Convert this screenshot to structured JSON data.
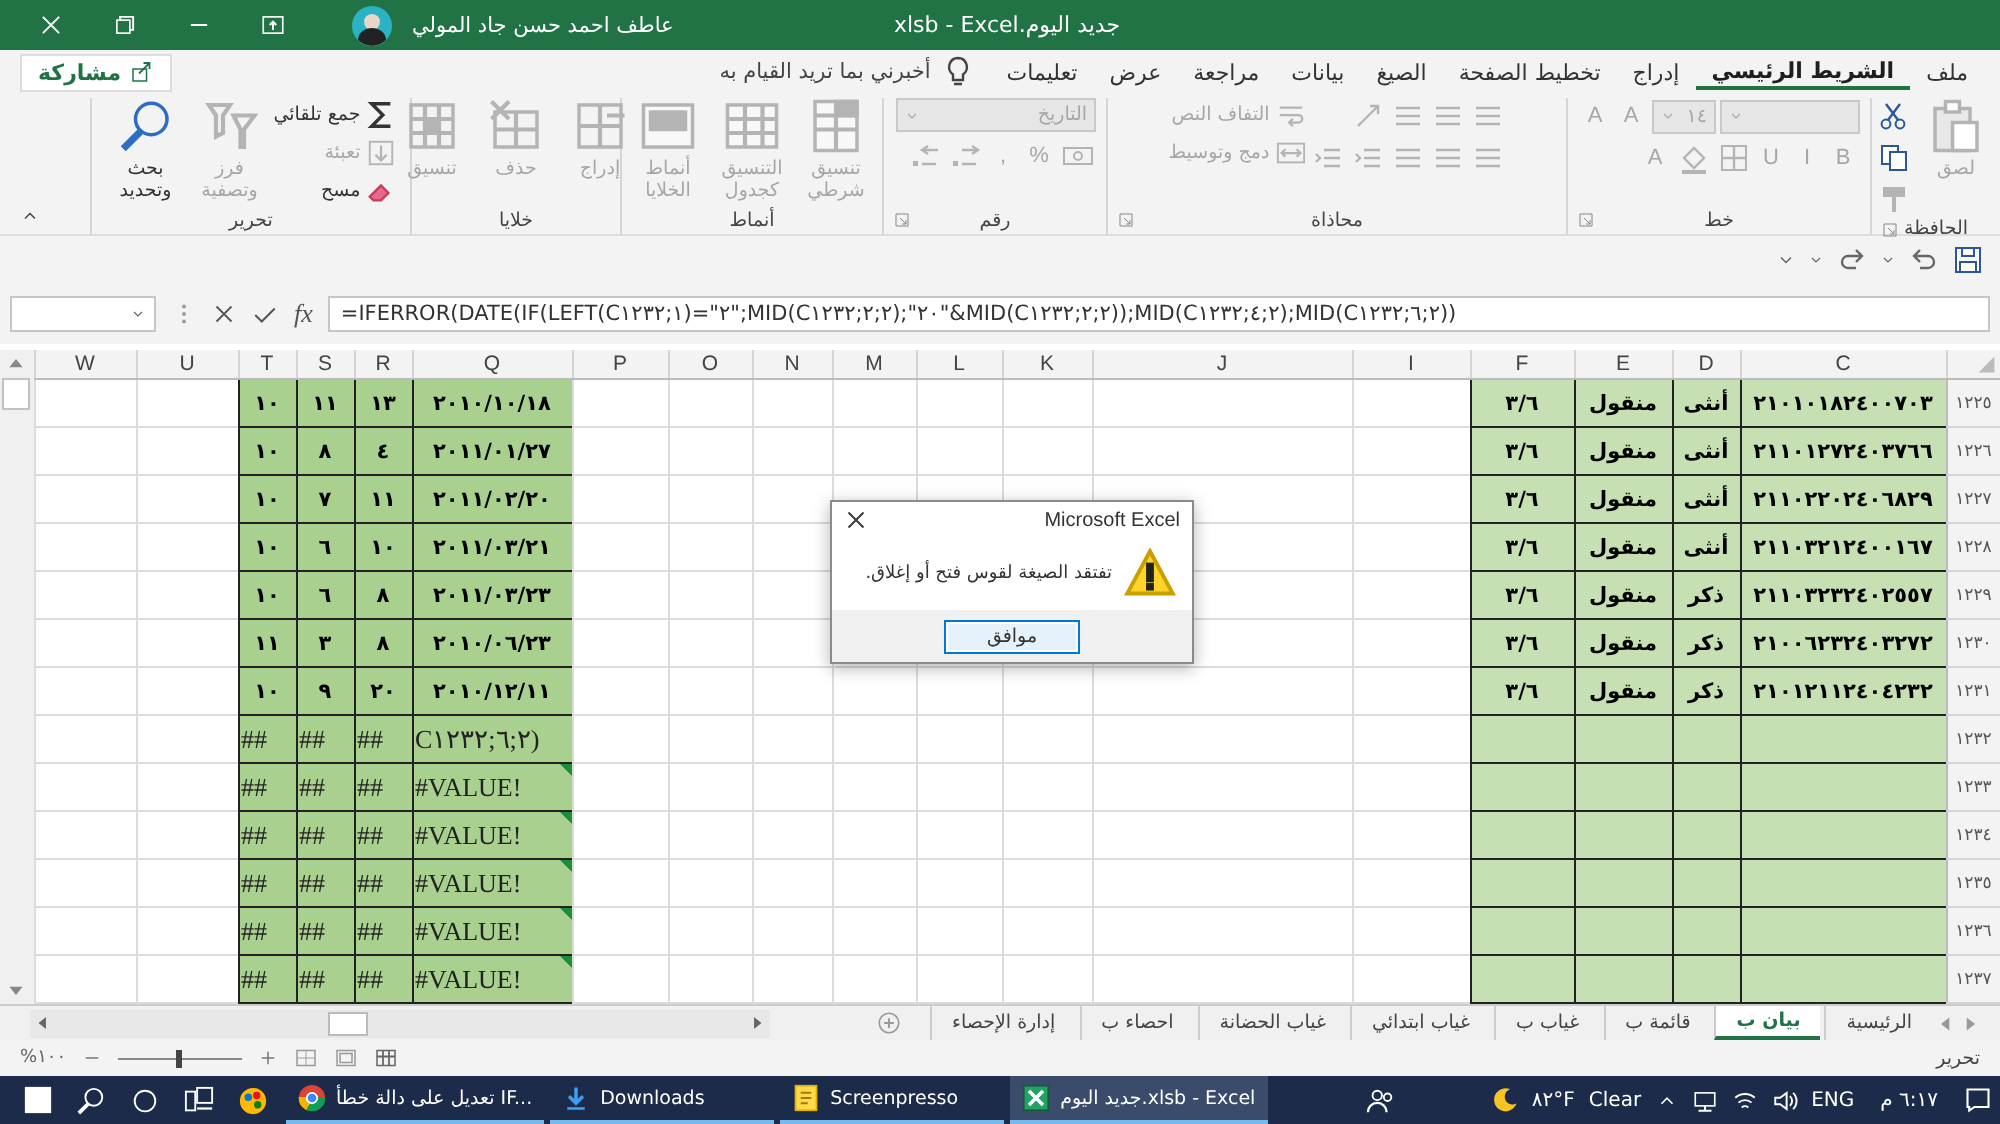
{
  "title_bar": {
    "title": "جديد اليوم.xlsb - Excel",
    "user": "عاطف احمد حسن جاد المولي"
  },
  "ribbon_tabs": [
    {
      "label": "ملف",
      "selected": false
    },
    {
      "label": "الشريط الرئيسي",
      "selected": true
    },
    {
      "label": "إدراج",
      "selected": false
    },
    {
      "label": "تخطيط الصفحة",
      "selected": false
    },
    {
      "label": "الصيغ",
      "selected": false
    },
    {
      "label": "بيانات",
      "selected": false
    },
    {
      "label": "مراجعة",
      "selected": false
    },
    {
      "label": "عرض",
      "selected": false
    },
    {
      "label": "تعليمات",
      "selected": false
    }
  ],
  "tell_me": {
    "placeholder": "أخبرني بما تريد القيام به"
  },
  "share_button": "مشاركة",
  "ribbon_groups": [
    {
      "label": "الحافظة",
      "has_launcher": true,
      "columns": [
        [
          {
            "kind": "large",
            "label": "لصق",
            "disabled": true
          }
        ],
        [
          {
            "kind": "icon",
            "disabled": false
          },
          {
            "kind": "icon",
            "disabled": false
          },
          {
            "kind": "icon",
            "disabled": true
          }
        ]
      ]
    },
    {
      "label": "خط",
      "has_launcher": true,
      "columns": [
        [
          {
            "kind": "row",
            "items": [
              {
                "kind": "field",
                "disabled": true
              },
              {
                "kind": "field",
                "value": "١٤",
                "disabled": true
              },
              {
                "kind": "glyph",
                "label": "A",
                "disabled": true
              },
              {
                "kind": "glyph",
                "label": "A",
                "disabled": true
              }
            ]
          },
          {
            "kind": "row",
            "items": [
              {
                "kind": "glyph",
                "label": "B",
                "disabled": true
              },
              {
                "kind": "glyph",
                "label": "I",
                "disabled": true
              },
              {
                "kind": "glyph",
                "label": "U",
                "disabled": true
              },
              {
                "kind": "icon",
                "disabled": true
              },
              {
                "kind": "icon",
                "disabled": true
              },
              {
                "kind": "glyph",
                "label": "A",
                "disabled": true
              }
            ]
          }
        ]
      ]
    },
    {
      "label": "محاذاة",
      "has_launcher": true,
      "columns": [
        [
          {
            "kind": "row",
            "items": [
              {
                "kind": "icon",
                "disabled": true
              },
              {
                "kind": "icon",
                "disabled": true
              },
              {
                "kind": "icon",
                "disabled": true
              }
            ]
          },
          {
            "kind": "row",
            "items": [
              {
                "kind": "icon",
                "disabled": true
              },
              {
                "kind": "icon",
                "disabled": true
              },
              {
                "kind": "icon",
                "disabled": true
              }
            ]
          }
        ],
        [
          {
            "kind": "row",
            "items": [
              {
                "kind": "icon",
                "disabled": true
              }
            ]
          },
          {
            "kind": "row",
            "items": [
              {
                "kind": "icon",
                "disabled": true
              },
              {
                "kind": "icon",
                "disabled": true
              }
            ]
          }
        ],
        [
          {
            "kind": "small",
            "label": "التفاف النص",
            "disabled": true
          },
          {
            "kind": "small",
            "label": "دمج وتوسيط",
            "disabled": true
          }
        ]
      ]
    },
    {
      "label": "رقم",
      "has_launcher": true,
      "columns": [
        [
          {
            "kind": "field",
            "value": "التاريخ",
            "disabled": true
          },
          {
            "kind": "row",
            "items": [
              {
                "kind": "icon",
                "disabled": true
              },
              {
                "kind": "glyph",
                "label": "%",
                "disabled": true
              },
              {
                "kind": "glyph",
                "label": ",",
                "disabled": true
              },
              {
                "kind": "icon",
                "disabled": true
              },
              {
                "kind": "icon",
                "disabled": true
              }
            ]
          }
        ]
      ]
    },
    {
      "label": "أنماط",
      "has_launcher": false,
      "columns": [
        [
          {
            "kind": "large",
            "label": "تنسيق شرطي",
            "disabled": true
          }
        ],
        [
          {
            "kind": "large",
            "label": "التنسيق كجدول",
            "disabled": true
          }
        ],
        [
          {
            "kind": "large",
            "label": "أنماط الخلايا",
            "disabled": true
          }
        ]
      ]
    },
    {
      "label": "خلايا",
      "has_launcher": false,
      "columns": [
        [
          {
            "kind": "large",
            "label": "إدراج",
            "disabled": true
          }
        ],
        [
          {
            "kind": "large",
            "label": "حذف",
            "disabled": true
          }
        ],
        [
          {
            "kind": "large",
            "label": "تنسيق",
            "disabled": true
          }
        ]
      ]
    },
    {
      "label": "تحرير",
      "has_launcher": false,
      "columns": [
        [
          {
            "kind": "small",
            "label": "جمع تلقائي",
            "disabled": false
          },
          {
            "kind": "small",
            "label": "تعبئة",
            "disabled": true
          },
          {
            "kind": "small",
            "label": "مسح",
            "disabled": false
          }
        ],
        [
          {
            "kind": "large",
            "label": "فرز وتصفية",
            "disabled": true
          }
        ],
        [
          {
            "kind": "large",
            "label": "بحث وتحديد",
            "disabled": false
          }
        ]
      ]
    }
  ],
  "formula_bar": {
    "function_label": "fx",
    "formula": "=IFERROR(DATE(IF(LEFT(C١٢٣٢;١)=\"٢\";MID(C١٢٣٢;٢;٢);\"٢٠\"&MID(C١٢٣٢;٢;٢));MID(C١٢٣٢;٤;٢);MID(C١٢٣٢;٦;٢))"
  },
  "sheet": {
    "columns": [
      {
        "label": "C",
        "color": "#c6e0b4"
      },
      {
        "label": "D",
        "color": "#c6e0b4"
      },
      {
        "label": "E",
        "color": "#c6e0b4"
      },
      {
        "label": "F",
        "color": "#c6e0b4"
      },
      {
        "label": "I"
      },
      {
        "label": "J"
      },
      {
        "label": "K"
      },
      {
        "label": "L"
      },
      {
        "label": "M"
      },
      {
        "label": "N"
      },
      {
        "label": "O"
      },
      {
        "label": "P"
      },
      {
        "label": "Q",
        "color": "#a9d08e"
      },
      {
        "label": "R",
        "color": "#a9d08e"
      },
      {
        "label": "S",
        "color": "#a9d08e"
      },
      {
        "label": "T",
        "color": "#a9d08e"
      },
      {
        "label": "U"
      },
      {
        "label": "W"
      }
    ],
    "rows": [
      {
        "header": "١٢٢٥",
        "kind": "data",
        "error_flag": false,
        "c": "٢١٠١٠١٨٢٤٠٠٧٠٣",
        "d": "أنثى",
        "e": "منقول",
        "f": "٣/٦",
        "q": "٢٠١٠/١٠/١٨",
        "r": "١٣",
        "s": "١١",
        "t": "١٠"
      },
      {
        "header": "١٢٢٦",
        "kind": "data",
        "error_flag": false,
        "c": "٢١١٠١٢٧٢٤٠٣٧٦٦",
        "d": "أنثى",
        "e": "منقول",
        "f": "٣/٦",
        "q": "٢٠١١/٠١/٢٧",
        "r": "٤",
        "s": "٨",
        "t": "١٠"
      },
      {
        "header": "١٢٢٧",
        "kind": "data",
        "error_flag": false,
        "c": "٢١١٠٢٢٠٢٤٠٦٨٢٩",
        "d": "أنثى",
        "e": "منقول",
        "f": "٣/٦",
        "q": "٢٠١١/٠٢/٢٠",
        "r": "١١",
        "s": "٧",
        "t": "١٠"
      },
      {
        "header": "١٢٢٨",
        "kind": "data",
        "error_flag": false,
        "c": "٢١١٠٣٢١٢٤٠٠١٦٧",
        "d": "أنثى",
        "e": "منقول",
        "f": "٣/٦",
        "q": "٢٠١١/٠٣/٢١",
        "r": "١٠",
        "s": "٦",
        "t": "١٠"
      },
      {
        "header": "١٢٢٩",
        "kind": "data",
        "error_flag": false,
        "c": "٢١١٠٣٢٣٢٤٠٢٥٥٧",
        "d": "ذكر",
        "e": "منقول",
        "f": "٣/٦",
        "q": "٢٠١١/٠٣/٢٣",
        "r": "٨",
        "s": "٦",
        "t": "١٠"
      },
      {
        "header": "١٢٣٠",
        "kind": "data",
        "error_flag": false,
        "c": "٢١٠٠٦٢٣٢٤٠٣٢٧٢",
        "d": "ذكر",
        "e": "منقول",
        "f": "٣/٦",
        "q": "٢٠١٠/٠٦/٢٣",
        "r": "٨",
        "s": "٣",
        "t": "١١"
      },
      {
        "header": "١٢٣١",
        "kind": "data",
        "error_flag": false,
        "c": "٢١٠١٢١١٢٤٠٤٢٣٢",
        "d": "ذكر",
        "e": "منقول",
        "f": "٣/٦",
        "q": "٢٠١٠/١٢/١١",
        "r": "٢٠",
        "s": "٩",
        "t": "١٠"
      },
      {
        "header": "١٢٣٢",
        "kind": "error",
        "error_flag": false,
        "q": "C١٢٣٢;٦;٢)",
        "r": "##",
        "s": "##",
        "t": "##"
      },
      {
        "header": "١٢٣٣",
        "kind": "error",
        "error_flag": true,
        "q": "#VALUE!",
        "r": "##",
        "s": "##",
        "t": "##"
      },
      {
        "header": "١٢٣٤",
        "kind": "error",
        "error_flag": true,
        "q": "#VALUE!",
        "r": "##",
        "s": "##",
        "t": "##"
      },
      {
        "header": "١٢٣٥",
        "kind": "error",
        "error_flag": true,
        "q": "#VALUE!",
        "r": "##",
        "s": "##",
        "t": "##"
      },
      {
        "header": "١٢٣٦",
        "kind": "error",
        "error_flag": true,
        "q": "#VALUE!",
        "r": "##",
        "s": "##",
        "t": "##"
      },
      {
        "header": "١٢٣٧",
        "kind": "error",
        "error_flag": true,
        "q": "#VALUE!",
        "r": "##",
        "s": "##",
        "t": "##"
      }
    ]
  },
  "dialog": {
    "title": "Microsoft Excel",
    "message": "تفتقد الصيغة لقوس فتح أو إغلاق.",
    "button": "موافق"
  },
  "sheet_tabs": [
    {
      "label": "الرئيسية",
      "selected": false
    },
    {
      "label": "بيان ب",
      "selected": true
    },
    {
      "label": "قائمة ب",
      "selected": false
    },
    {
      "label": "غياب ب",
      "selected": false
    },
    {
      "label": "غياب ابتدائي",
      "selected": false
    },
    {
      "label": "غياب الحضانة",
      "selected": false
    },
    {
      "label": "احصاء ب",
      "selected": false
    },
    {
      "label": "إدارة الإحصاء",
      "selected": false
    }
  ],
  "status_bar": {
    "mode": "تحرير",
    "zoom": "١٠٠%",
    "zoom_slider": {
      "level": 0.5
    }
  },
  "taskbar": {
    "apps": [
      {
        "label": "جديد اليوم.xlsb - Excel",
        "kind": "excel",
        "selected": true
      },
      {
        "label": "Screenpresso",
        "kind": "screenpresso",
        "selected": false
      },
      {
        "label": "Downloads",
        "kind": "folder",
        "selected": false
      },
      {
        "label": "تعديل على دالة خطأ IF...",
        "kind": "browser",
        "selected": false
      }
    ],
    "temperature": "٨٢°F",
    "weather": "Clear",
    "language": "ENG",
    "clock": "٦:١٧ م"
  }
}
